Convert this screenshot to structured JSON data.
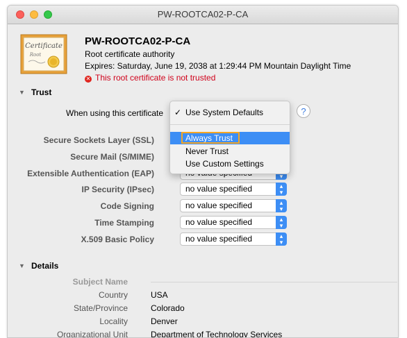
{
  "window": {
    "title": "PW-ROOTCA02-P-CA"
  },
  "certificate": {
    "name": "PW-ROOTCA02-P-CA",
    "type": "Root certificate authority",
    "expires": "Expires: Saturday, June 19, 2038 at 1:29:44 PM Mountain Daylight Time",
    "warning": "This root certificate is not trusted",
    "icon_text_1": "Certificate",
    "icon_text_2": "Root"
  },
  "trust": {
    "header": "Trust",
    "when_using": "When using this certificate",
    "help": "?",
    "dropdown": {
      "items": [
        "Use System Defaults",
        "Always Trust",
        "Never Trust",
        "Use Custom Settings"
      ],
      "checked": "Use System Defaults",
      "highlighted": "Always Trust"
    },
    "policies": [
      {
        "label": "Secure Sockets Layer (SSL)",
        "value": ""
      },
      {
        "label": "Secure Mail (S/MIME)",
        "value": ""
      },
      {
        "label": "Extensible Authentication (EAP)",
        "value": "no value specified"
      },
      {
        "label": "IP Security (IPsec)",
        "value": "no value specified"
      },
      {
        "label": "Code Signing",
        "value": "no value specified"
      },
      {
        "label": "Time Stamping",
        "value": "no value specified"
      },
      {
        "label": "X.509 Basic Policy",
        "value": "no value specified"
      }
    ]
  },
  "details": {
    "header": "Details",
    "subject_name": "Subject Name",
    "fields": [
      {
        "label": "Country",
        "value": "USA"
      },
      {
        "label": "State/Province",
        "value": "Colorado"
      },
      {
        "label": "Locality",
        "value": "Denver"
      },
      {
        "label": "Organizational Unit",
        "value": "Department of Technology Services"
      }
    ]
  },
  "colors": {
    "accent": "#3d8ef5",
    "warning": "#d0021b",
    "highlight_outline": "#f5a623"
  }
}
